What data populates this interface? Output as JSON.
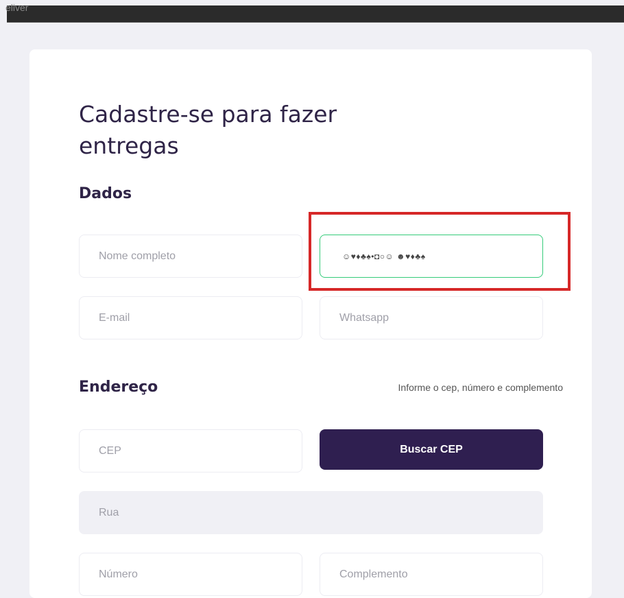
{
  "top_bar": {
    "text": "eliver"
  },
  "page": {
    "title": "Cadastre-se para fazer entregas"
  },
  "dados": {
    "title": "Dados",
    "name_placeholder": "Nome completo",
    "focused_value": "☺♥♦♣♠•◘○☺ ☻♥♦♣♠",
    "email_placeholder": "E-mail",
    "whatsapp_placeholder": "Whatsapp"
  },
  "endereco": {
    "title": "Endereço",
    "hint": "Informe o cep, número e complemento",
    "cep_placeholder": "CEP",
    "search_label": "Buscar CEP",
    "street_placeholder": "Rua",
    "number_placeholder": "Número",
    "complement_placeholder": "Complemento"
  },
  "colors": {
    "primary": "#2f1f50",
    "focus": "#34cb79",
    "highlight": "#d62828",
    "background": "#f0f0f5"
  }
}
